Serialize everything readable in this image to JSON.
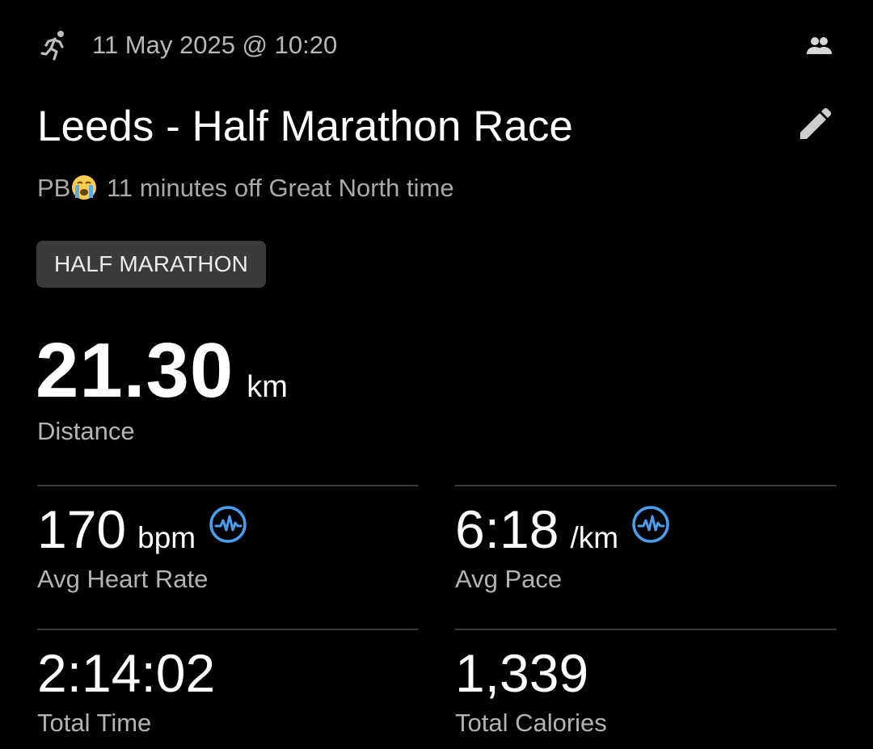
{
  "header": {
    "activity_type_icon": "running-person-icon",
    "datetime": "11 May 2025 @ 10:20",
    "social_icon": "people-icon"
  },
  "activity": {
    "title": "Leeds - Half Marathon Race",
    "edit_icon": "pencil-icon",
    "description_prefix": "PB",
    "description_emoji": "😭",
    "description_text": " 11 minutes off Great North time",
    "tag": "HALF MARATHON"
  },
  "distance": {
    "value": "21.30",
    "unit": "km",
    "label": "Distance"
  },
  "stats": {
    "heart_rate": {
      "value": "170",
      "unit": "bpm",
      "label": "Avg Heart Rate",
      "icon": "heart-rate-wave-icon"
    },
    "pace": {
      "value": "6:18",
      "unit": "/km",
      "label": "Avg Pace",
      "icon": "pace-wave-icon"
    },
    "time": {
      "value": "2:14:02",
      "label": "Total Time"
    },
    "calories": {
      "value": "1,339",
      "label": "Total Calories"
    }
  },
  "colors": {
    "background": "#000000",
    "accent_blue": "#4a9ef0",
    "tag_bg": "#3b3b3b",
    "muted_text": "#b4b4b4",
    "divider": "#3a3a3a"
  }
}
